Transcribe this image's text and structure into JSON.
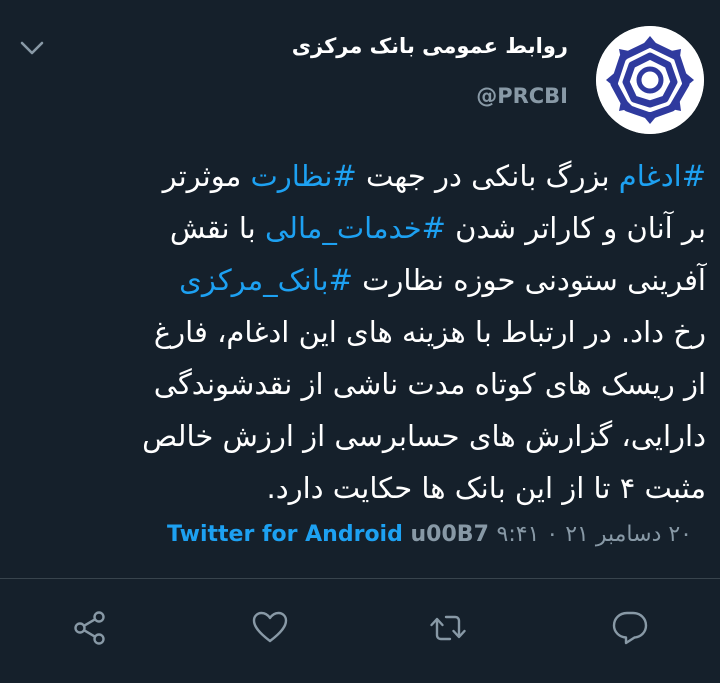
{
  "user": {
    "display_name": "روابط عمومی بانک مرکزی",
    "handle": "@PRCBI"
  },
  "tweet": {
    "lines": [
      [
        {
          "text": "#ادغام",
          "hashtag": true
        },
        {
          "text": " بزرگ بانکی در جهت ",
          "hashtag": false
        },
        {
          "text": "#نظارت",
          "hashtag": true
        },
        {
          "text": " موثرتر",
          "hashtag": false
        }
      ],
      [
        {
          "text": "بر آنان و کاراتر شدن ",
          "hashtag": false
        },
        {
          "text": "#خدمات_مالی",
          "hashtag": true
        },
        {
          "text": " با نقش",
          "hashtag": false
        }
      ],
      [
        {
          "text": "آفرینی ستودنی حوزه نظارت ",
          "hashtag": false
        },
        {
          "text": "#بانک_مرکزی",
          "hashtag": true
        }
      ],
      [
        {
          "text": "رخ داد. در ارتباط با هزینه های این ادغام، فارغ",
          "hashtag": false
        }
      ],
      [
        {
          "text": "از ریسک های کوتاه مدت ناشی از نقدشوندگی",
          "hashtag": false
        }
      ],
      [
        {
          "text": "دارایی، گزارش های حسابرسی از ارزش خالص",
          "hashtag": false
        }
      ],
      [
        {
          "text": "مثبت ۴ تا از این بانک ها حکایت دارد.",
          "hashtag": false
        }
      ]
    ]
  },
  "meta": {
    "source": "Twitter for Android",
    "separator": " u00B7 ",
    "datetime": "۲۰ دسامبر ۲۱ ۰ ۹:۴۱"
  },
  "actions": [
    {
      "name": "share-icon"
    },
    {
      "name": "like-icon"
    },
    {
      "name": "retweet-icon"
    },
    {
      "name": "reply-icon"
    }
  ],
  "colors": {
    "background": "#15202b",
    "accent": "#1da1f2",
    "secondary_text": "#8899a6",
    "divider": "#38444d",
    "logo_blue": "#2f3a9e"
  }
}
